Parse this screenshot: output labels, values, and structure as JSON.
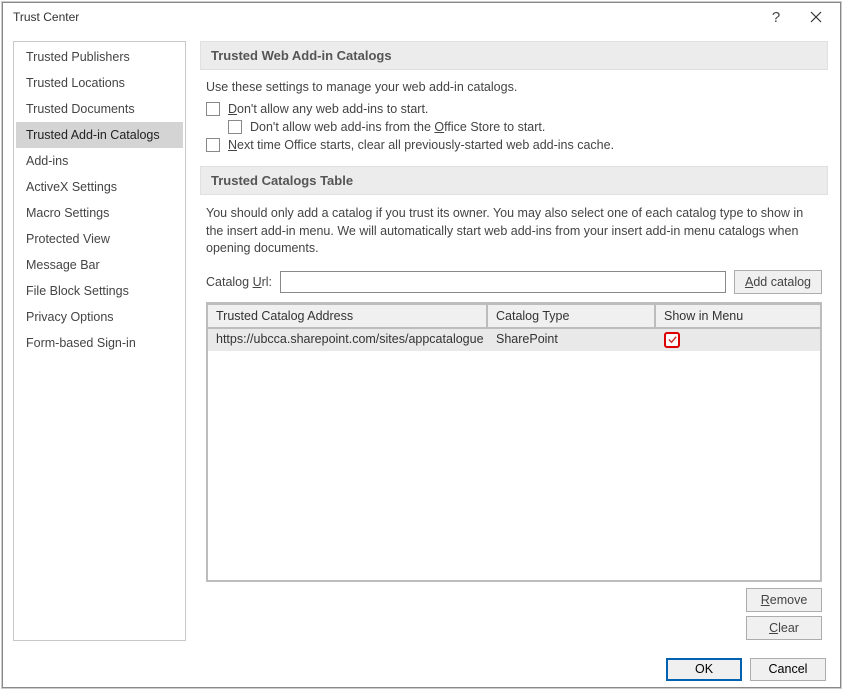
{
  "title": "Trust Center",
  "sidebar": {
    "items": [
      {
        "label": "Trusted Publishers"
      },
      {
        "label": "Trusted Locations"
      },
      {
        "label": "Trusted Documents"
      },
      {
        "label": "Trusted Add-in Catalogs"
      },
      {
        "label": "Add-ins"
      },
      {
        "label": "ActiveX Settings"
      },
      {
        "label": "Macro Settings"
      },
      {
        "label": "Protected View"
      },
      {
        "label": "Message Bar"
      },
      {
        "label": "File Block Settings"
      },
      {
        "label": "Privacy Options"
      },
      {
        "label": "Form-based Sign-in"
      }
    ],
    "selected_index": 3
  },
  "sections": {
    "web_addins": {
      "header": "Trusted Web Add-in Catalogs",
      "intro": "Use these settings to manage your web add-in catalogs.",
      "chk_dont_allow_pre": "D",
      "chk_dont_allow_post": "on't allow any web add-ins to start.",
      "chk_office_store_pre": "Don't allow web add-ins from the ",
      "chk_office_store_u": "O",
      "chk_office_store_post": "ffice Store to start.",
      "chk_next_time_pre": "N",
      "chk_next_time_post": "ext time Office starts, clear all previously-started web add-ins cache."
    },
    "catalogs": {
      "header": "Trusted Catalogs Table",
      "desc": "You should only add a catalog if you trust its owner. You may also select one of each catalog type to show in the insert add-in menu. We will automatically start web add-ins from your insert add-in menu catalogs when opening documents.",
      "url_label_pre": "Catalog ",
      "url_label_u": "U",
      "url_label_post": "rl:",
      "url_value": "",
      "add_btn_u": "A",
      "add_btn_post": "dd catalog",
      "columns": {
        "addr": "Trusted Catalog Address",
        "type": "Catalog Type",
        "show": "Show in Menu"
      },
      "rows": [
        {
          "addr": "https://ubcca.sharepoint.com/sites/appcatalogue",
          "type": "SharePoint",
          "show": true
        }
      ],
      "remove_u": "R",
      "remove_post": "emove",
      "clear_u": "C",
      "clear_post": "lear"
    }
  },
  "footer": {
    "ok": "OK",
    "cancel": "Cancel"
  }
}
